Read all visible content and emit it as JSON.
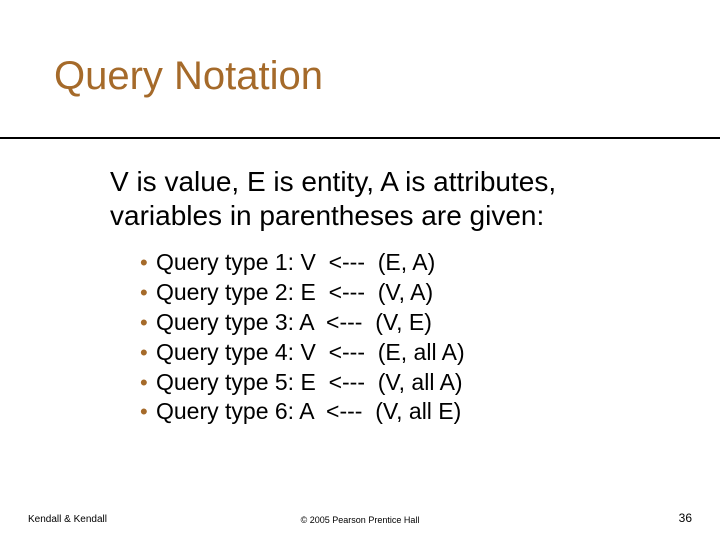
{
  "title": "Query Notation",
  "intro": "V is value, E is entity, A is attributes, variables in parentheses are given:",
  "bullets": [
    "Query type 1: V  <---  (E, A)",
    "Query type 2: E  <---  (V, A)",
    "Query type 3: A  <---  (V, E)",
    "Query type 4: V  <---  (E, all A)",
    "Query type 5: E  <---  (V, all A)",
    "Query type 6: A  <---  (V, all E)"
  ],
  "footer": {
    "left": "Kendall & Kendall",
    "center": "© 2005 Pearson Prentice Hall",
    "right": "36"
  }
}
